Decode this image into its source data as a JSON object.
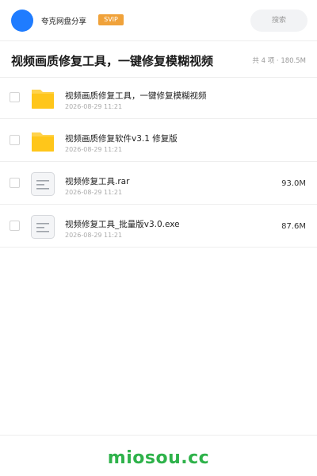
{
  "header": {
    "app_name": "夸克网盘分享",
    "badge": "SVIP",
    "search_placeholder": "搜索",
    "avatar_color": "#1f7cff"
  },
  "share": {
    "title": "视频画质修复工具，一键修复模糊视频",
    "summary": "共 4 项 · 180.5M"
  },
  "files": [
    {
      "name": "视频画质修复工具，一键修复模糊视频",
      "date": "2026-08-29 11:21",
      "size": "",
      "icon": "folder-icon"
    },
    {
      "name": "视频画质修复软件v3.1 修复版",
      "date": "2026-08-29 11:21",
      "size": "",
      "icon": "folder-icon"
    },
    {
      "name": "视频修复工具.rar",
      "date": "2026-08-29 11:21",
      "size": "93.0M",
      "icon": "file-icon"
    },
    {
      "name": "视频修复工具_批量版v3.0.exe",
      "date": "2026-08-29 11:21",
      "size": "87.6M",
      "icon": "file-icon"
    }
  ],
  "footer": {
    "watermark": "miosou.cc",
    "watermark_color": "#2eb24a"
  },
  "colors": {
    "folder": "#ffc61a",
    "badge": "#f0a23a"
  }
}
